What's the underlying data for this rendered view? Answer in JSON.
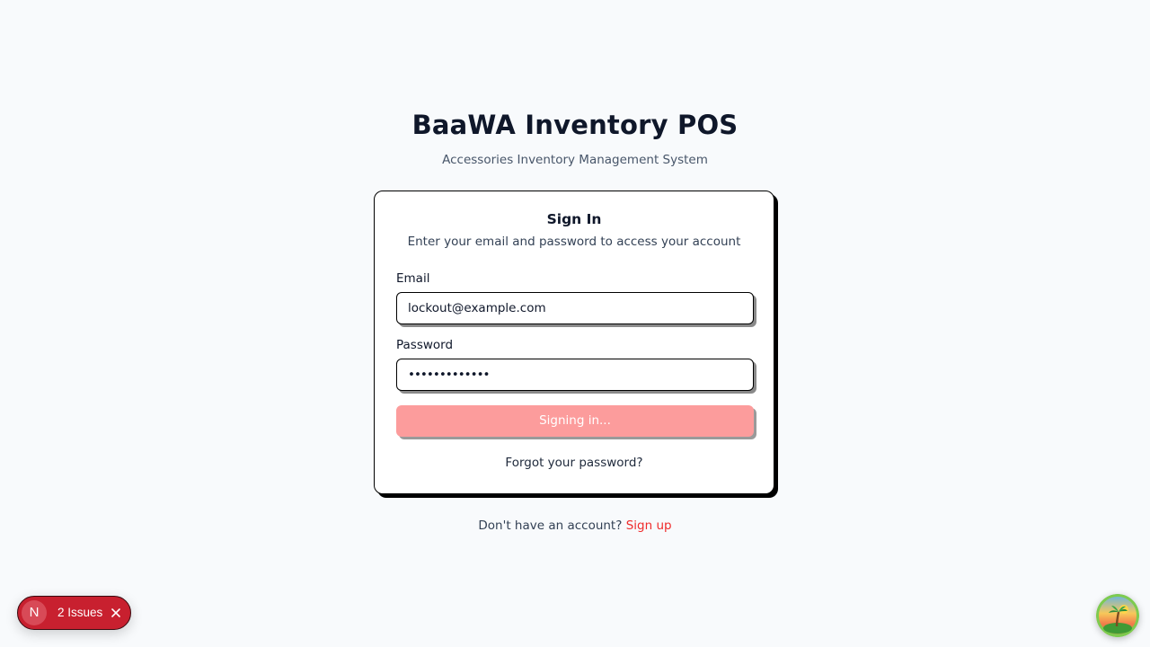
{
  "header": {
    "app_title": "BaaWA Inventory POS",
    "app_subtitle": "Accessories Inventory Management System"
  },
  "signin_card": {
    "title": "Sign In",
    "description": "Enter your email and password to access your account",
    "email": {
      "label": "Email",
      "value": "lockout@example.com"
    },
    "password": {
      "label": "Password",
      "value": "•••••••••••••"
    },
    "submit_label": "Signing in...",
    "forgot_label": "Forgot your password?"
  },
  "footer": {
    "prompt": "Don't have an account?",
    "signup_label": "Sign up"
  },
  "dev_indicator": {
    "logo_letter": "N",
    "issues_label": "2 Issues"
  },
  "colors": {
    "background": "#f8fafc",
    "accent_red": "#ef2b2b",
    "button_disabled": "#fc9c9c",
    "issues_badge": "#c8202f"
  },
  "icons": {
    "issues_close": "close-icon",
    "avatar": "palm-tree-sunset-avatar"
  }
}
